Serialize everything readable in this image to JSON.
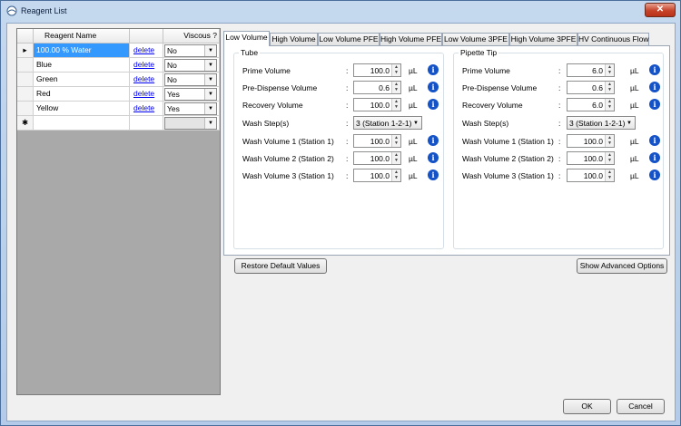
{
  "window": {
    "title": "Reagent List",
    "close_label": "✕"
  },
  "grid": {
    "headers": {
      "name": "Reagent Name",
      "delete": "",
      "viscous": "Viscous ?"
    },
    "rows": [
      {
        "name": "100.00 % Water",
        "delete": "delete",
        "viscous": "No"
      },
      {
        "name": "Blue",
        "delete": "delete",
        "viscous": "No"
      },
      {
        "name": "Green",
        "delete": "delete",
        "viscous": "No"
      },
      {
        "name": "Red",
        "delete": "delete",
        "viscous": "Yes"
      },
      {
        "name": "Yellow",
        "delete": "delete",
        "viscous": "Yes"
      }
    ],
    "current_row_marker": "▸",
    "new_row_marker": "✱",
    "new_row_viscous": ""
  },
  "tabs": [
    "Low Volume",
    "High Volume",
    "Low Volume PFE",
    "High Volume PFE",
    "Low Volume 3PFE",
    "High Volume 3PFE",
    "HV Continuous Flow"
  ],
  "active_tab": "Low Volume",
  "tube": {
    "title": "Tube",
    "fields": {
      "prime_volume": {
        "label": "Prime Volume",
        "value": "100.0",
        "unit": "µL"
      },
      "pre_dispense_volume": {
        "label": "Pre-Dispense Volume",
        "value": "0.6",
        "unit": "µL"
      },
      "recovery_volume": {
        "label": "Recovery Volume",
        "value": "100.0",
        "unit": "µL"
      },
      "wash_steps": {
        "label": "Wash Step(s)",
        "value": "3 (Station 1-2-1)"
      },
      "wash_volume_1": {
        "label": "Wash Volume 1 (Station 1)",
        "value": "100.0",
        "unit": "µL"
      },
      "wash_volume_2": {
        "label": "Wash Volume 2 (Station 2)",
        "value": "100.0",
        "unit": "µL"
      },
      "wash_volume_3": {
        "label": "Wash Volume 3 (Station 1)",
        "value": "100.0",
        "unit": "µL"
      }
    }
  },
  "pipette": {
    "title": "Pipette Tip",
    "fields": {
      "prime_volume": {
        "label": "Prime Volume",
        "value": "6.0",
        "unit": "µL"
      },
      "pre_dispense_volume": {
        "label": "Pre-Dispense Volume",
        "value": "0.6",
        "unit": "µL"
      },
      "recovery_volume": {
        "label": "Recovery Volume",
        "value": "6.0",
        "unit": "µL"
      },
      "wash_steps": {
        "label": "Wash Step(s)",
        "value": "3 (Station 1-2-1)"
      },
      "wash_volume_1": {
        "label": "Wash Volume 1 (Station 1)",
        "value": "100.0",
        "unit": "µL"
      },
      "wash_volume_2": {
        "label": "Wash Volume 2 (Station 2)",
        "value": "100.0",
        "unit": "µL"
      },
      "wash_volume_3": {
        "label": "Wash Volume 3 (Station 1)",
        "value": "100.0",
        "unit": "µL"
      }
    }
  },
  "colon": ":",
  "info_glyph": "i",
  "buttons": {
    "restore": "Restore Default Values",
    "advanced": "Show Advanced Options",
    "ok": "OK",
    "cancel": "Cancel"
  },
  "colors": {
    "selection": "#3399ff",
    "info": "#1452c8",
    "title_bar": "#b9cfe9"
  }
}
